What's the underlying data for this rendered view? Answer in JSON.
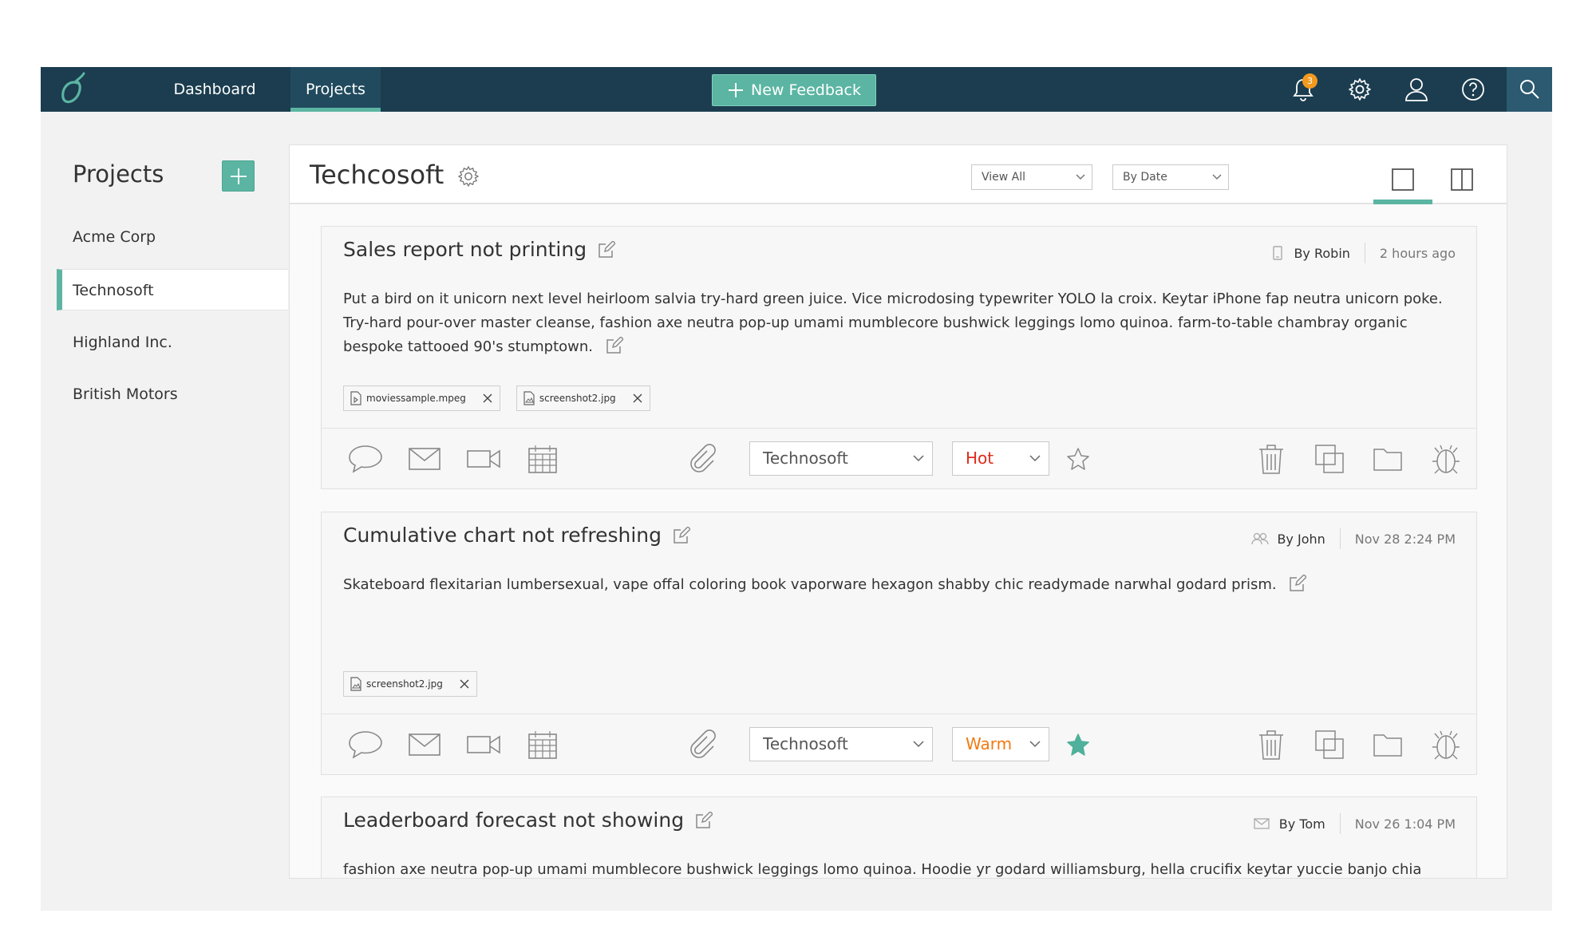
{
  "nav": {
    "tabs": [
      {
        "label": "Dashboard",
        "active": false
      },
      {
        "label": "Projects",
        "active": true
      }
    ],
    "new_feedback_label": "New Feedback",
    "notification_count": "3",
    "icons": [
      "bell-icon",
      "gear-icon",
      "user-icon",
      "help-icon",
      "search-icon"
    ]
  },
  "sidebar": {
    "title": "Projects",
    "items": [
      {
        "label": "Acme Corp",
        "active": false
      },
      {
        "label": "Technosoft",
        "active": true
      },
      {
        "label": "Highland Inc.",
        "active": false
      },
      {
        "label": "British Motors",
        "active": false
      }
    ]
  },
  "main": {
    "title": "Techcosoft",
    "filter_view": "View All",
    "filter_sort": "By Date"
  },
  "cards": [
    {
      "title": "Sales report not printing",
      "author": "By Robin",
      "when": "2 hours ago",
      "source_icon": "phone-icon",
      "body": "Put a bird on it unicorn next level heirloom salvia try-hard green juice. Vice microdosing typewriter YOLO la croix. Keytar iPhone fap neutra unicorn poke. Try-hard pour-over master cleanse, fashion axe neutra pop-up umami mumblecore bushwick leggings lomo quinoa. farm-to-table chambray organic bespoke tattooed 90's stumptown.",
      "attachments": [
        "moviessample.mpeg",
        "screenshot2.jpg"
      ],
      "project": "Technosoft",
      "temperature": "Hot",
      "temperature_color": "#e02a1c",
      "starred": false
    },
    {
      "title": "Cumulative chart not refreshing",
      "author": "By John",
      "when": "Nov 28  2:24 PM",
      "source_icon": "users-icon",
      "body": "Skateboard flexitarian lumbersexual, vape offal coloring book vaporware hexagon shabby chic readymade narwhal godard prism.",
      "attachments": [
        "screenshot2.jpg"
      ],
      "project": "Technosoft",
      "temperature": "Warm",
      "temperature_color": "#f07a10",
      "starred": true
    },
    {
      "title": "Leaderboard forecast not showing",
      "author": "By Tom",
      "when": "Nov 26  1:04 PM",
      "source_icon": "mail-icon",
      "body": "fashion axe neutra pop-up umami mumblecore bushwick leggings lomo quinoa. Hoodie yr godard williamsburg, hella crucifix keytar yuccie banjo chia"
    }
  ],
  "colors": {
    "topbar": "#1b3d4f",
    "accent": "#5bb5a2",
    "badge": "#f29a1f"
  }
}
